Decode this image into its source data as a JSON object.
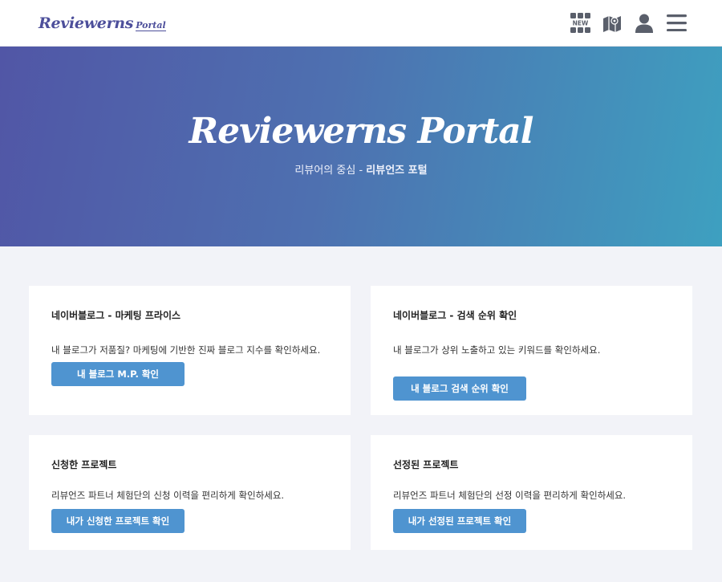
{
  "header": {
    "logo_main": "Reviewerns",
    "logo_sub": "Portal",
    "icons": [
      "new-grid-icon",
      "map-icon",
      "user-icon",
      "menu-icon"
    ],
    "new_badge": "NEW"
  },
  "hero": {
    "title": "Reviewerns Portal",
    "subtitle_prefix": "리뷰어의 중심 - ",
    "subtitle_bold": "리뷰언즈 포털"
  },
  "cards": [
    {
      "title": "네이버블로그 - 마케팅 프라이스",
      "desc": "내 블로그가 저품질? 마케팅에 기반한 진짜 블로그 지수를 확인하세요.",
      "button": "내 블로그 M.P. 확인"
    },
    {
      "title": "네이버블로그 - 검색 순위 확인",
      "desc": "내 블로그가 상위 노출하고 있는 키워드를 확인하세요.",
      "button": "내 블로그 검색 순위 확인"
    },
    {
      "title": "신청한 프로젝트",
      "desc": "리뷰언즈 파트너 체험단의 신청 이력을 편리하게 확인하세요.",
      "button": "내가 신청한 프로젝트 확인"
    },
    {
      "title": "선정된 프로젝트",
      "desc": "리뷰언즈 파트너 체험단의 선정 이력을 편리하게 확인하세요.",
      "button": "내가 선정된 프로젝트 확인"
    }
  ],
  "colors": {
    "brand": "#4d4f9b",
    "button": "#4f94d0",
    "hero_start": "#5156a6",
    "hero_end": "#3ea0c0",
    "icon": "#5a5f6b"
  }
}
